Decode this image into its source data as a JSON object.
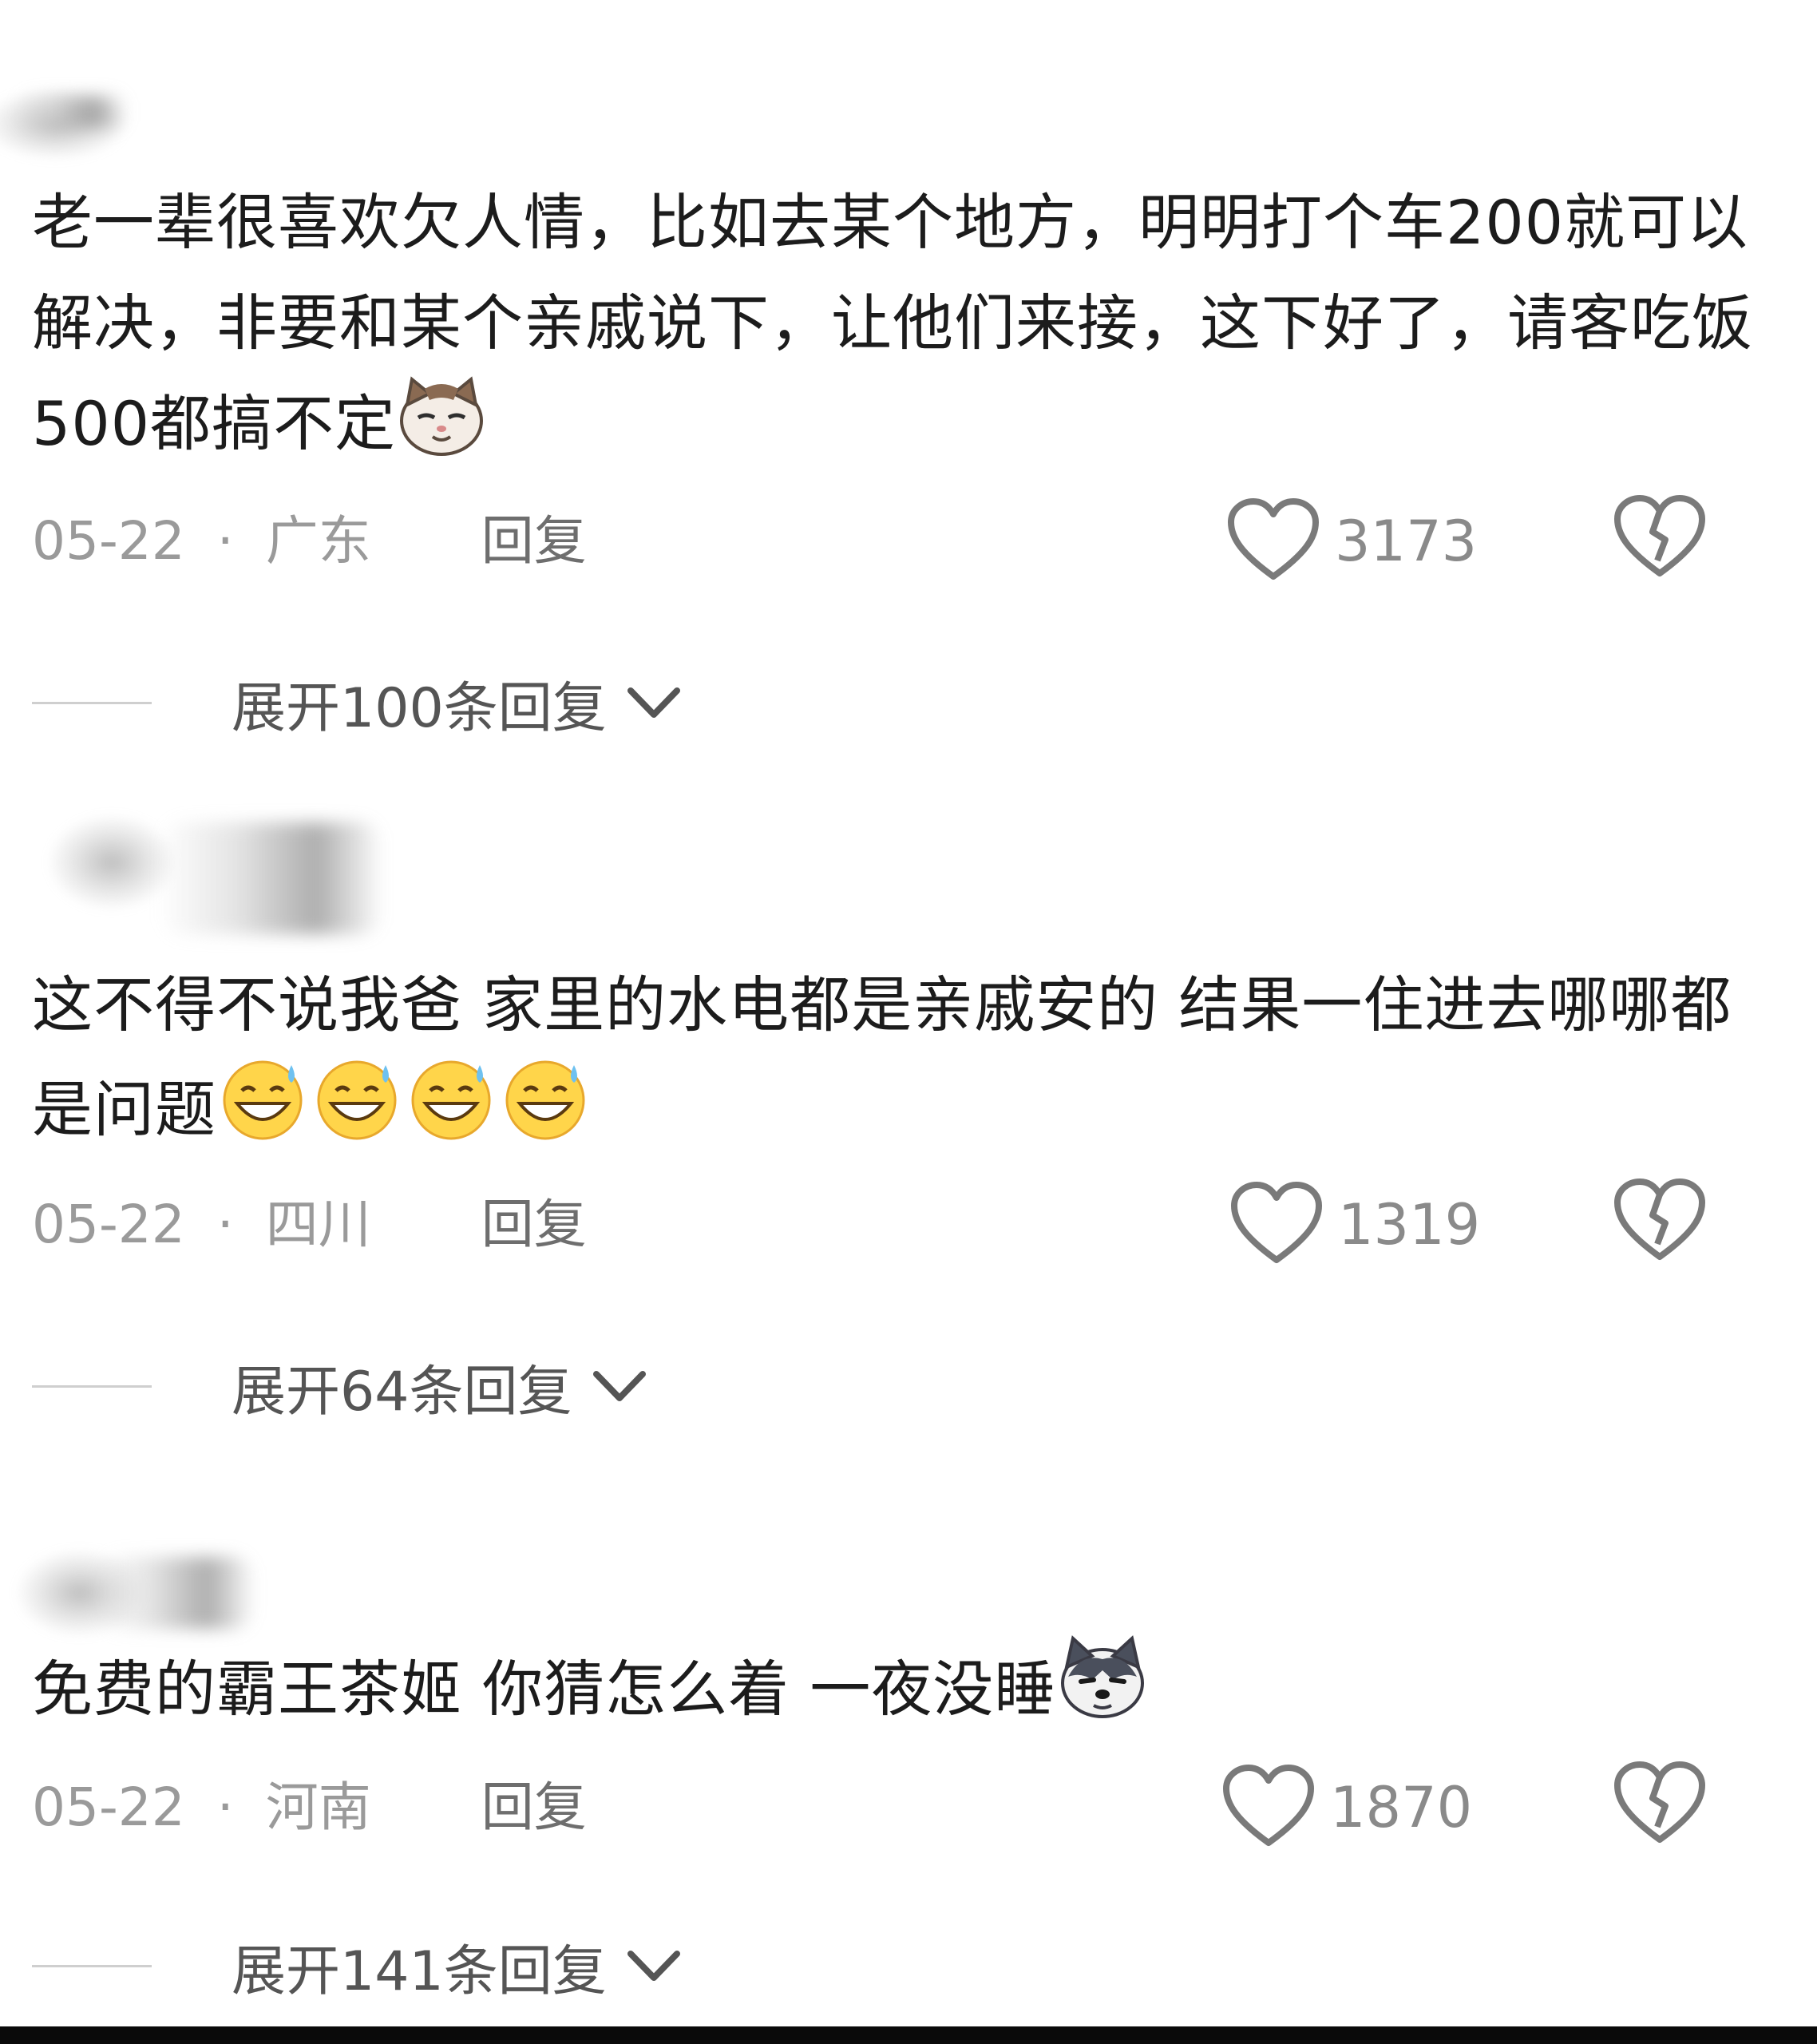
{
  "comments": [
    {
      "text": "老一辈很喜欢欠人情，比如去某个地方，明明打个车200就可以解决，非要和某个亲戚说下，让他们来接，这下好了，请客吃饭500都搞不定",
      "emoji": "cat-emoji",
      "date": "05-22",
      "separator": "·",
      "region": "广东",
      "reply_label": "回复",
      "likes": "3173",
      "expand_label": "展开100条回复"
    },
    {
      "text": "这不得不说我爸 家里的水电都是亲戚安的 结果一住进去哪哪都是问题",
      "emoji": "sweat-smile-emoji",
      "date": "05-22",
      "separator": "·",
      "region": "四川",
      "reply_label": "回复",
      "likes": "1319",
      "expand_label": "展开64条回复"
    },
    {
      "text": "免费的霸王茶姬 你猜怎么着 一夜没睡",
      "emoji": "husky-emoji",
      "date": "05-22",
      "separator": "·",
      "region": "河南",
      "reply_label": "回复",
      "likes": "1870",
      "expand_label": "展开141条回复"
    }
  ],
  "icons": {
    "like": "heart-outline-icon",
    "dislike": "broken-heart-icon",
    "expand": "chevron-down-icon"
  },
  "colors": {
    "text": "#1c1c1c",
    "meta": "#9a9a9a",
    "icon": "#7a7a7a"
  }
}
